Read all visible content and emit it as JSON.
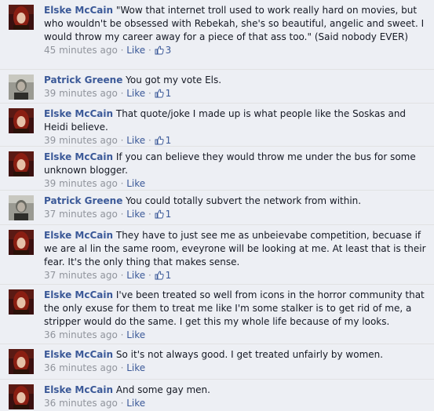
{
  "comments": [
    {
      "author": "Elske McCain",
      "avatar": "elske",
      "text": "\"Wow that internet troll used to work really hard on movies, but who wouldn't be obsessed with Rebekah, she's so beautiful, angelic and sweet. I would throw my career away for a piece of that ass too.\" (Said nobody EVER)",
      "time": "45 minutes ago",
      "like_label": "Like",
      "likes": "3"
    },
    {
      "author": "Patrick Greene",
      "avatar": "patrick",
      "text": "You got my vote Els.",
      "time": "39 minutes ago",
      "like_label": "Like",
      "likes": "1"
    },
    {
      "author": "Elske McCain",
      "avatar": "elske",
      "text": "That quote/joke I made up is what people like the Soskas and Heidi believe.",
      "time": "39 minutes ago",
      "like_label": "Like",
      "likes": "1"
    },
    {
      "author": "Elske McCain",
      "avatar": "elske",
      "text": "If you can believe they would throw me under the bus for some unknown blogger.",
      "time": "39 minutes ago",
      "like_label": "Like",
      "likes": ""
    },
    {
      "author": "Patrick Greene",
      "avatar": "patrick",
      "text": "You could totally subvert the network from within.",
      "time": "37 minutes ago",
      "like_label": "Like",
      "likes": "1"
    },
    {
      "author": "Elske McCain",
      "avatar": "elske",
      "text": "They have to just see me as unbeievabe competition, becuase if we are al lin the same room, eveyrone will be looking at me. At least that is their fear. It's the only thing that makes sense.",
      "time": "37 minutes ago",
      "like_label": "Like",
      "likes": "1"
    },
    {
      "author": "Elske McCain",
      "avatar": "elske",
      "text": "I've been treated so well from icons in the horror community that the only exuse for them to treat me like I'm some stalker is to get rid of me, a stripper would do the same. I get this my whole life because of my looks.",
      "time": "36 minutes ago",
      "like_label": "Like",
      "likes": ""
    },
    {
      "author": "Elske McCain",
      "avatar": "elske",
      "text": "So it's not always good. I get treated unfairly by women.",
      "time": "36 minutes ago",
      "like_label": "Like",
      "likes": ""
    },
    {
      "author": "Elske McCain",
      "avatar": "elske",
      "text": "And some gay men.",
      "time": "36 minutes ago",
      "like_label": "Like",
      "likes": ""
    }
  ],
  "separator": " · ",
  "colors": {
    "background": "#edeff4",
    "link": "#3b5998",
    "meta": "#90949c",
    "text": "#141823"
  }
}
